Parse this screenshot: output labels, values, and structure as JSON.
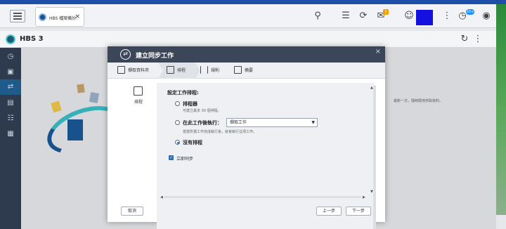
{
  "browser": {
    "tab_title": "HBS 檔案備份...",
    "tab_close": "×",
    "notification_count": "1",
    "badge_count": "10+"
  },
  "app": {
    "title": "HBS 3"
  },
  "background": {
    "hint_text": "最新一次，隨時隨地存取資料。"
  },
  "modal": {
    "title": "建立同步工作",
    "close": "×",
    "steps": [
      {
        "label": "擷取資料夾",
        "icon": "folder-sync-icon"
      },
      {
        "label": "排程",
        "icon": "calendar-icon"
      },
      {
        "label": "規則",
        "icon": "sliders-icon"
      },
      {
        "label": "摘要",
        "icon": "clipboard-icon"
      }
    ],
    "side_tab_label": "排程",
    "section_title": "設定工作排程:",
    "options": [
      {
        "label": "排程器",
        "note": "可建立最多 30 個排程。",
        "selected": false
      },
      {
        "label": "在此工作後執行：",
        "note": "當當所選工作完成執行後，就會執行這項工作。",
        "selected": false
      },
      {
        "label": "沒有排程",
        "note": "",
        "selected": true
      }
    ],
    "select_value": "擷取工作",
    "checkbox_label": "立即同步",
    "checkbox_checked": true,
    "buttons": {
      "cancel": "取消",
      "back": "上一步",
      "next": "下一步"
    }
  },
  "colors": {
    "accent": "#2a6ebb",
    "header": "#3b4658",
    "sidebar": "#2e3a4d"
  }
}
